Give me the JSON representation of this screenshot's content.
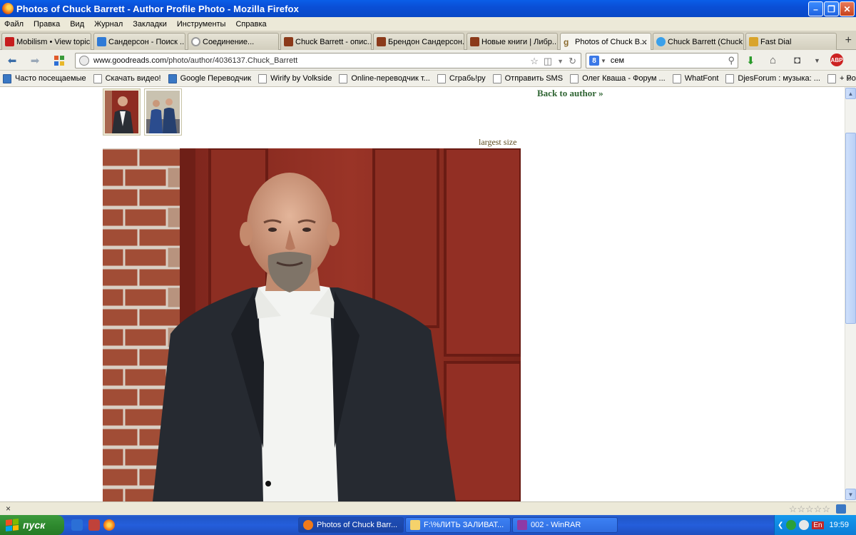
{
  "window": {
    "title": "Photos of Chuck Barrett - Author Profile Photo - Mozilla Firefox"
  },
  "menu": [
    "Файл",
    "Правка",
    "Вид",
    "Журнал",
    "Закладки",
    "Инструменты",
    "Справка"
  ],
  "tabs": [
    {
      "label": "Mobilism • View topic ...",
      "icon": "mobilism-icon",
      "color": "#c61d1d"
    },
    {
      "label": "Сандерсон - Поиск ...",
      "icon": "dropbox-icon",
      "color": "#2f7ad6"
    },
    {
      "label": "Соединение...",
      "icon": "loading-icon",
      "color": "#999999"
    },
    {
      "label": "Chuck Barrett - опис...",
      "icon": "book-icon",
      "color": "#8b3a1a"
    },
    {
      "label": "Брендон Сандерсон...",
      "icon": "book-icon",
      "color": "#8b3a1a"
    },
    {
      "label": "Новые книги | Либр...",
      "icon": "book-icon",
      "color": "#8b3a1a"
    },
    {
      "label": "Photos of Chuck B...",
      "icon": "goodreads-icon",
      "color": "#b08c47",
      "active": true
    },
    {
      "label": "Chuck Barrett (Chuck...",
      "icon": "twitter-icon",
      "color": "#3aa0ea"
    },
    {
      "label": "Fast Dial",
      "icon": "fastdial-icon",
      "color": "#d9a42b"
    }
  ],
  "navbar": {
    "url_host": "www.goodreads.com",
    "url_path": "/photo/author/4036137.Chuck_Barrett",
    "search_query": "сем",
    "search_engine_letter": "8"
  },
  "bookmarks": [
    {
      "label": "Часто посещаемые",
      "special": true
    },
    {
      "label": "Скачать видео!"
    },
    {
      "label": "Google Переводчик",
      "special": true
    },
    {
      "label": "Wirify by Volkside"
    },
    {
      "label": "Online-переводчик т..."
    },
    {
      "label": "Сграбь!ру"
    },
    {
      "label": "Отправить SMS"
    },
    {
      "label": "Олег Кваша - Форум ..."
    },
    {
      "label": "WhatFont"
    },
    {
      "label": "DjesForum : музыка: ..."
    },
    {
      "label": "+ Pocket"
    }
  ],
  "bookmarks_more": "»",
  "content": {
    "back_link": "Back to author »",
    "largest_size": "largest size"
  },
  "addonbar": {
    "close": "×",
    "stars": "☆☆☆☆☆"
  },
  "taskbar": {
    "start_label": "пуск",
    "tasks": [
      {
        "label": "Photos of Chuck Barr...",
        "icon": "firefox-icon",
        "color": "#f07a1a",
        "active": true
      },
      {
        "label": "F:\\%ЛИТЬ ЗАЛИВАТ...",
        "icon": "folder-icon",
        "color": "#f5d26b"
      },
      {
        "label": "002 - WinRAR",
        "icon": "winrar-icon",
        "color": "#8e3aa6"
      }
    ],
    "tray_lang": "En",
    "clock": "19:59"
  }
}
